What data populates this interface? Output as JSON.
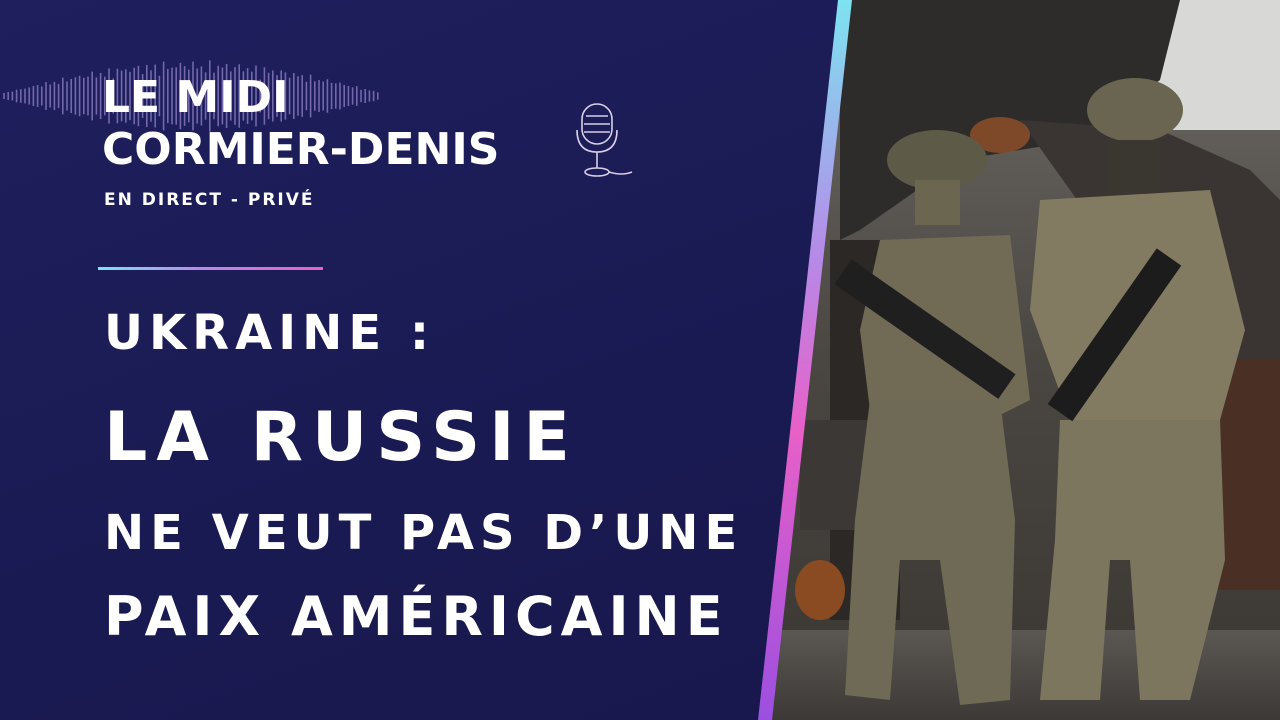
{
  "show": {
    "title_line1": "LE MIDI",
    "title_line2": "CORMIER-DENIS",
    "subtitle": "EN DIRECT - PRIVÉ"
  },
  "headline": {
    "line1": "UKRAINE :",
    "line2": "LA RUSSIE",
    "line3": "NE VEUT PAS D’UNE",
    "line4": "PAIX AMÉRICAINE"
  },
  "icons": {
    "waveform": "audio-waveform-icon",
    "microphone": "microphone-icon"
  },
  "colors": {
    "background": "#1b1b55",
    "text": "#ffffff",
    "accent_cyan": "#7de3f0",
    "accent_magenta": "#e860c8"
  }
}
